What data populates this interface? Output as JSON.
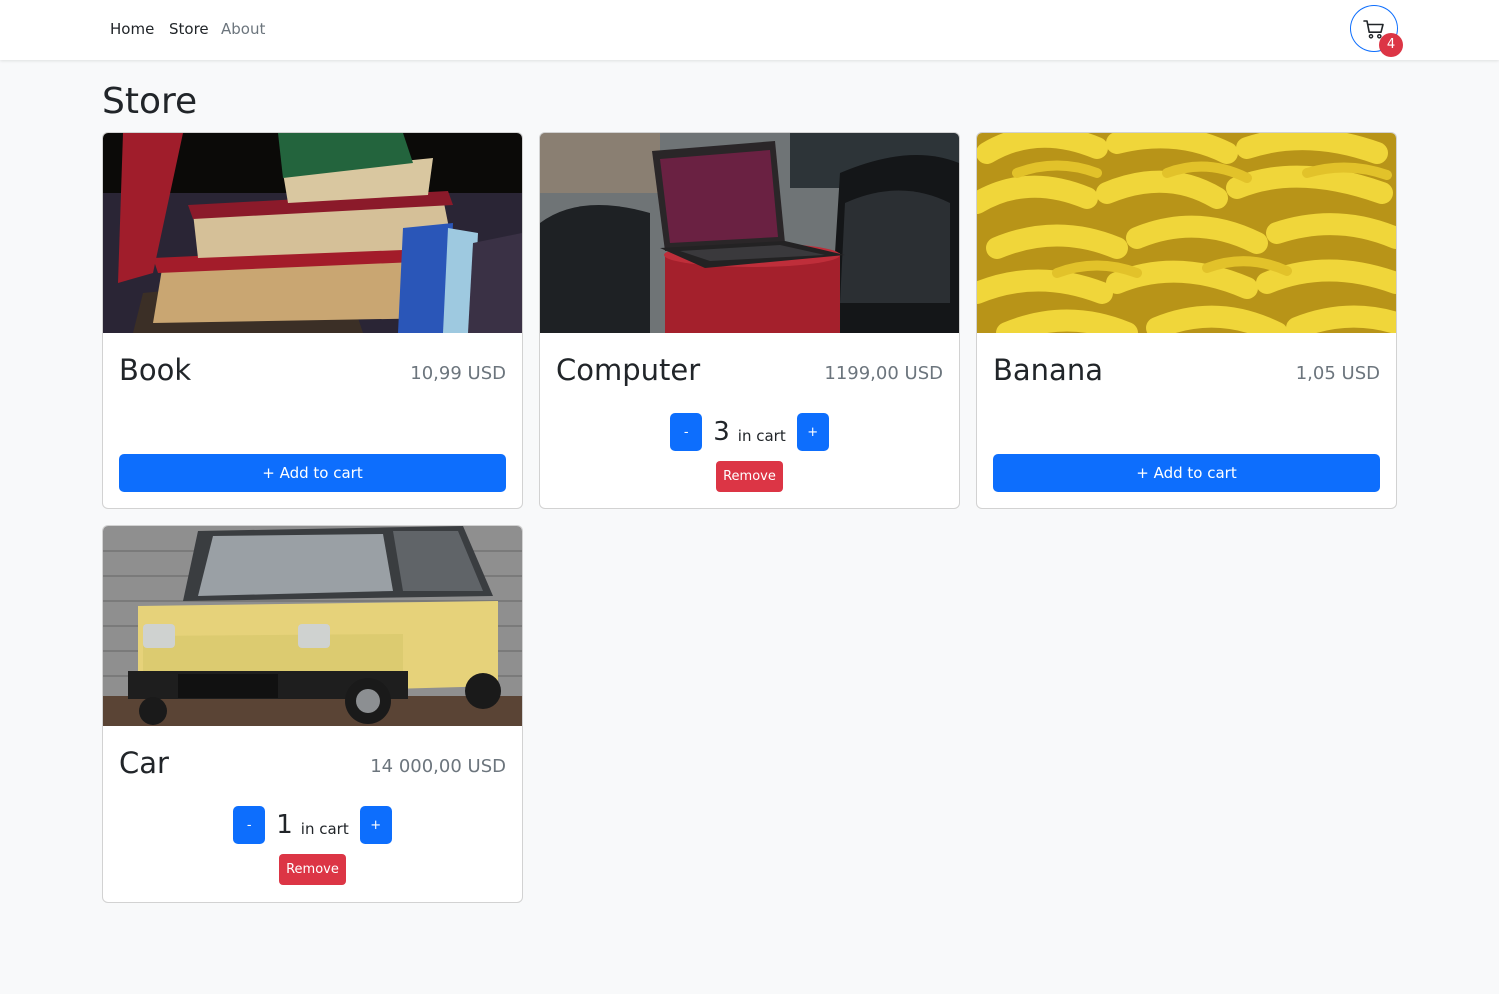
{
  "nav": {
    "home": "Home",
    "store": "Store",
    "about": "About",
    "cart_count": "4"
  },
  "page": {
    "title": "Store"
  },
  "products": [
    {
      "name": "Book",
      "price": "10,99 USD",
      "action": "+ Add to cart"
    },
    {
      "name": "Computer",
      "price": "1199,00 USD",
      "quantity": "3",
      "in_cart_label": "in cart",
      "minus": "-",
      "plus": "+",
      "remove": "Remove"
    },
    {
      "name": "Banana",
      "price": "1,05 USD",
      "action": "+ Add to cart"
    },
    {
      "name": "Car",
      "price": "14 000,00 USD",
      "quantity": "1",
      "in_cart_label": "in cart",
      "minus": "-",
      "plus": "+",
      "remove": "Remove"
    }
  ],
  "colors": {
    "primary": "#0d6efd",
    "danger": "#dc3545",
    "muted": "#6c757d",
    "background": "#f8f9fa"
  },
  "icons": {
    "cart": "cart-icon"
  }
}
